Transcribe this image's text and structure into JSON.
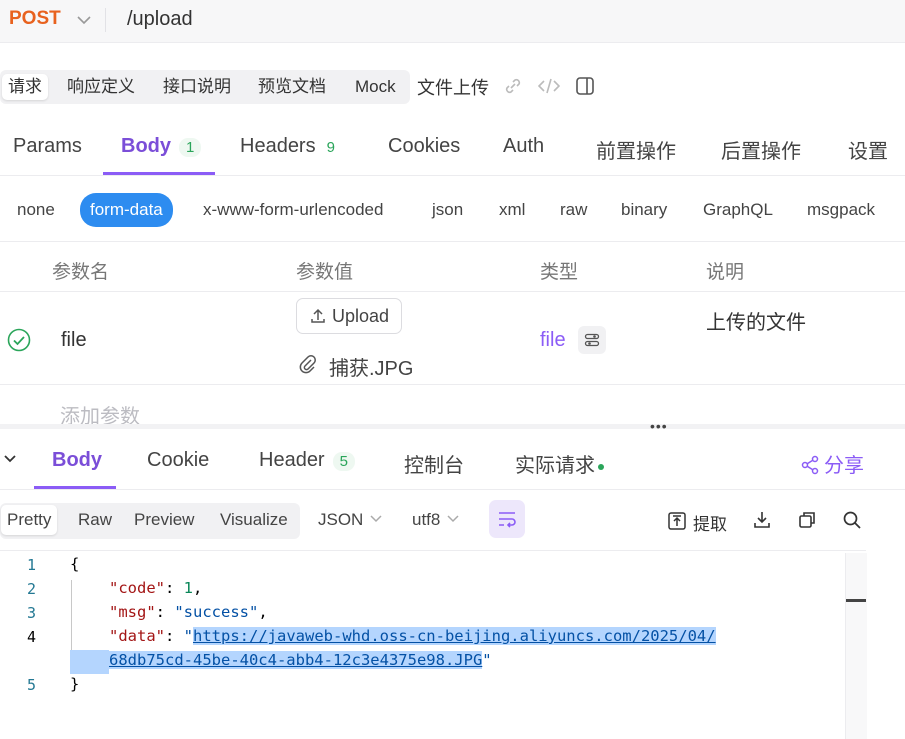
{
  "request": {
    "method": "POST",
    "url": "/upload"
  },
  "doc_tabs": [
    "请求",
    "响应定义",
    "接口说明",
    "预览文档",
    "Mock"
  ],
  "doc_title": "文件上传",
  "main_tabs": {
    "params": "Params",
    "body": "Body",
    "body_count": "1",
    "headers": "Headers",
    "headers_count": "9",
    "cookies": "Cookies",
    "auth": "Auth",
    "pre": "前置操作",
    "post": "后置操作",
    "settings": "设置"
  },
  "body_types": [
    "none",
    "form-data",
    "x-www-form-urlencoded",
    "json",
    "xml",
    "raw",
    "binary",
    "GraphQL",
    "msgpack"
  ],
  "params_table": {
    "headers": [
      "参数名",
      "参数值",
      "类型",
      "说明"
    ],
    "row": {
      "name": "file",
      "upload_label": "Upload",
      "file_name": "捕获.JPG",
      "type": "file",
      "description": "上传的文件"
    },
    "add_param": "添加参数"
  },
  "response_tabs": {
    "body": "Body",
    "cookie": "Cookie",
    "header": "Header",
    "header_count": "5",
    "console": "控制台",
    "actual": "实际请求",
    "share": "分享"
  },
  "response_toolbar": {
    "views": [
      "Pretty",
      "Raw",
      "Preview",
      "Visualize"
    ],
    "format": "JSON",
    "encoding": "utf8",
    "extract": "提取"
  },
  "code": {
    "line_numbers": [
      "1",
      "2",
      "3",
      "4",
      "",
      "5"
    ],
    "open": "{",
    "close": "}",
    "code_key": "\"code\"",
    "code_val": "1",
    "msg_key": "\"msg\"",
    "msg_val": "\"success\"",
    "data_key": "\"data\"",
    "data_url_1": "https://javaweb-whd.oss-cn-beijing.aliyuncs.com/2025/04/",
    "data_url_2": "68db75cd-45be-40c4-abb4-12c3e4375e98.JPG"
  },
  "colors": {
    "accent": "#8b5cf6",
    "method": "#e8621f",
    "active_type": "#2d8cf0",
    "success": "#2aa55a"
  }
}
